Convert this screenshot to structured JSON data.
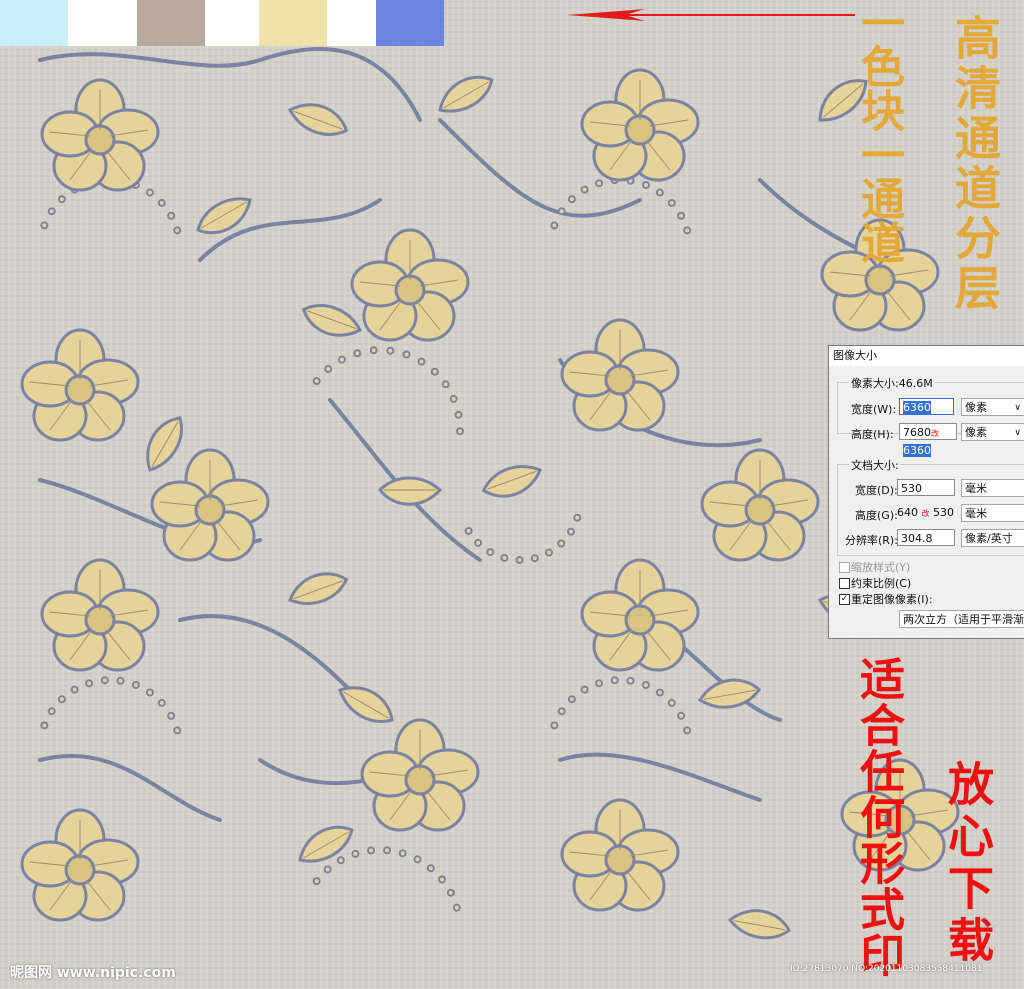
{
  "swatches": [
    {
      "color": "#c9eef5"
    },
    {
      "color": "#ffffff"
    },
    {
      "color": "#b7a99d"
    },
    {
      "color": "#ffffff"
    },
    {
      "color": "#f0e1ab"
    },
    {
      "color": "#ffffff"
    },
    {
      "color": "#6c85df"
    }
  ],
  "colors": {
    "background": "#d2d0c8",
    "flower": "#e6d39a",
    "stem": "#7b83a2",
    "annotation_gold": "#e2a93a",
    "annotation_red": "#ee1111",
    "arrow_red": "#e21c1c"
  },
  "annotations": {
    "color_block_note": "一色块一通道",
    "layer_note": "高清通道分层",
    "print_note": "适合任何形式印",
    "download_note": "放心下载"
  },
  "dialog": {
    "title": "图像大小",
    "pixel_size": "像素大小:46.6M",
    "width_label": "宽度(W):",
    "width_value": "6360",
    "width_unit": "像素",
    "height_label": "高度(H):",
    "height_old": "7680",
    "height_mark": "改",
    "height_value": "6360",
    "height_unit": "像素",
    "doc_size": "文档大小:",
    "doc_width_label": "宽度(D):",
    "doc_width_value": "530",
    "doc_width_unit": "毫米",
    "doc_height_label": "高度(G):",
    "doc_height_old": "640",
    "doc_height_mark": "改",
    "doc_height_value": "530",
    "doc_height_unit": "毫米",
    "resolution_label": "分辨率(R):",
    "resolution_value": "304.8",
    "resolution_unit": "像素/英寸",
    "scale_styles": "缩放样式(Y)",
    "constrain": "约束比例(C)",
    "resample": "重定图像像素(I):",
    "resample_method": "两次立方（适用于平滑渐变"
  },
  "watermark_left": "昵图网 www.nipic.com",
  "watermark_right": "ID:27813070 NO:20201103083558411081"
}
